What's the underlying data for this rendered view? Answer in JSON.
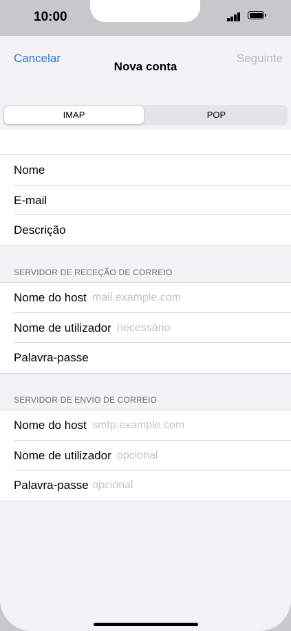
{
  "status_bar": {
    "time": "10:00"
  },
  "nav": {
    "cancel": "Cancelar",
    "title": "Nova conta",
    "next": "Seguinte"
  },
  "segments": {
    "imap": "IMAP",
    "pop": "POP"
  },
  "account": {
    "name_label": "Nome",
    "email_label": "E-mail",
    "description_label": "Descrição"
  },
  "incoming": {
    "title": "SERVIDOR DE RECEÇÃO DE CORREIO",
    "host_label": "Nome do host",
    "host_placeholder": "mail.example.com",
    "user_label": "Nome de utilizador",
    "user_placeholder": "necessário",
    "password_label": "Palavra-passe"
  },
  "outgoing": {
    "title": "SERVIDOR DE ENVIO DE CORREIO",
    "host_label": "Nome do host",
    "host_placeholder": "smtp.example.com",
    "user_label": "Nome de utilizador",
    "user_placeholder": "opcional",
    "password_label": "Palavra-passe",
    "password_placeholder": "opcional"
  },
  "colors": {
    "accent": "#2f78d8",
    "disabled": "#b9b9be",
    "background": "#f2f2f7"
  }
}
